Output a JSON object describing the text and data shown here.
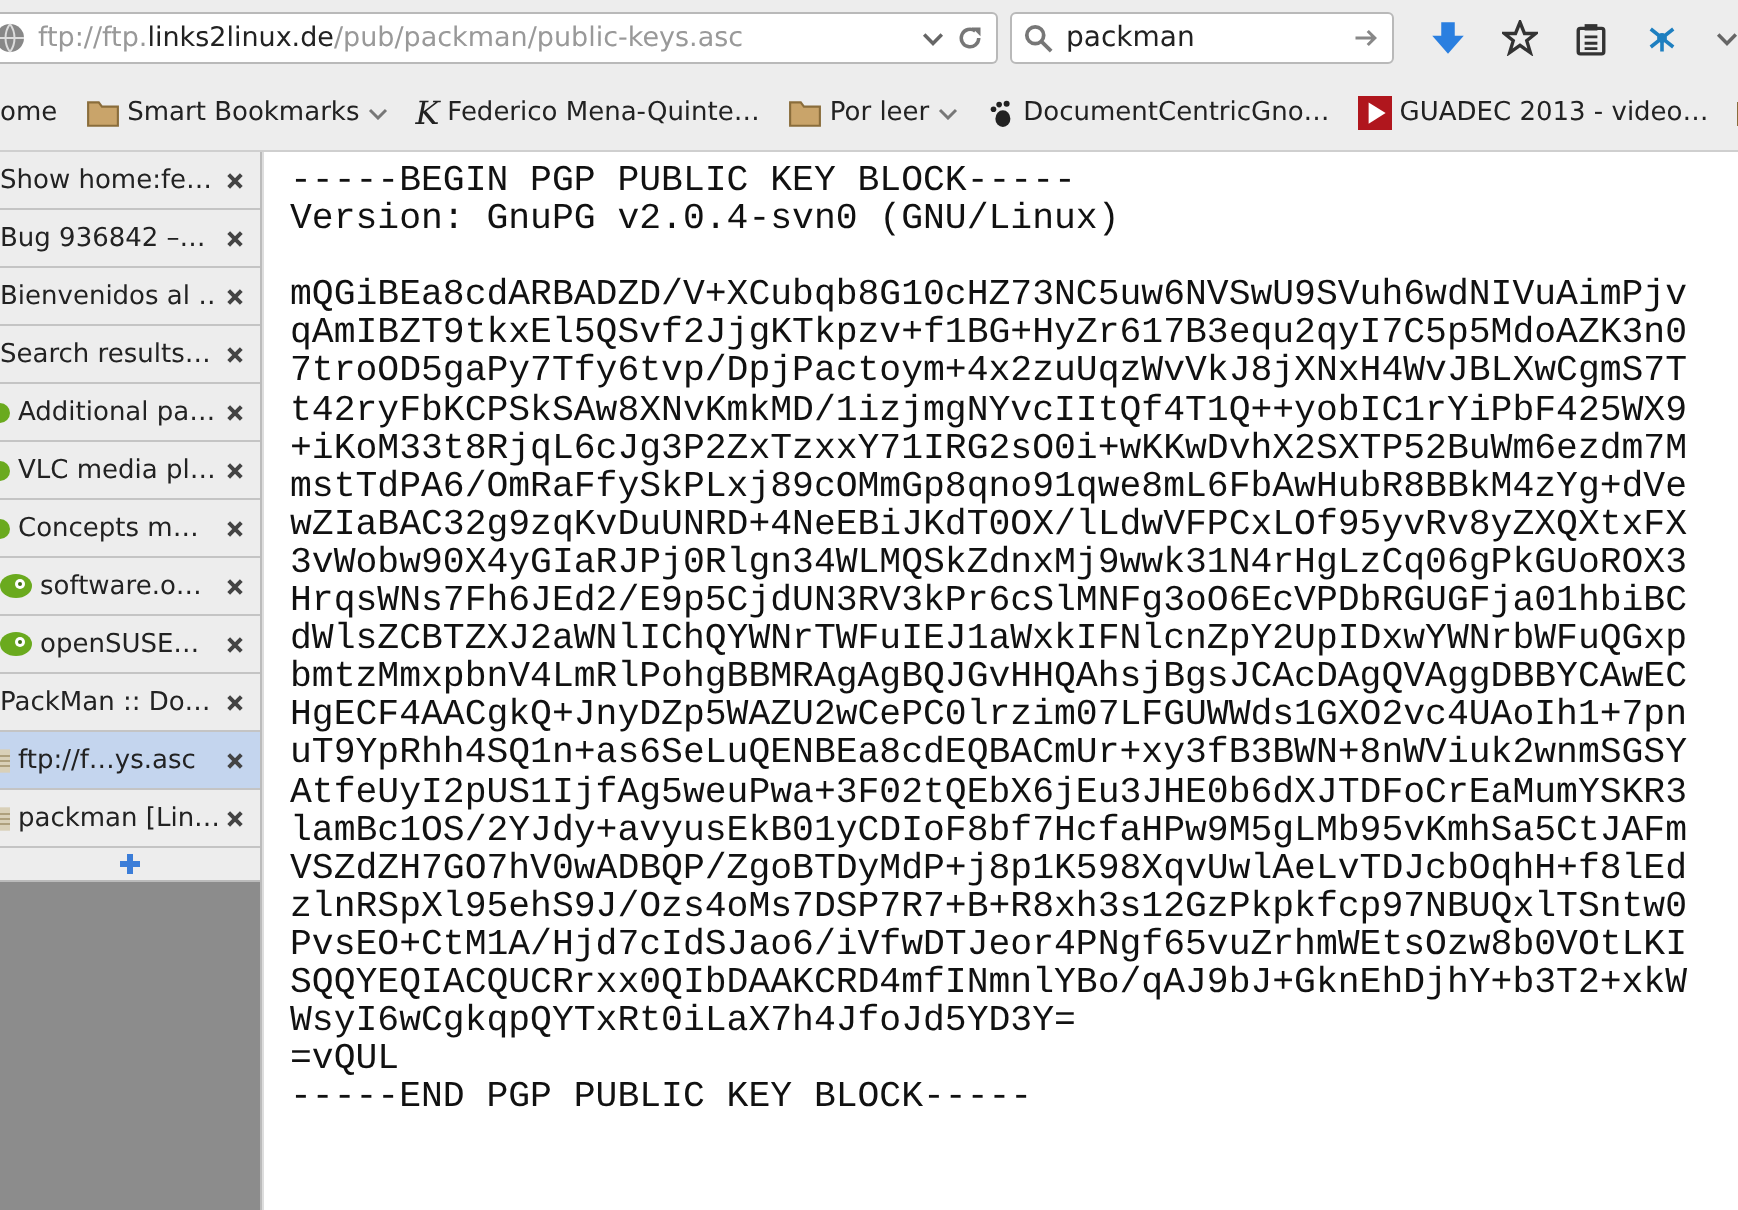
{
  "toolbar": {
    "url": {
      "scheme": "ftp://ftp.",
      "domain": "links2linux.de",
      "path": "/pub/packman/public-keys.asc"
    },
    "search": {
      "value": "packman"
    }
  },
  "bookmarks": [
    {
      "label": "ome",
      "kind": "none",
      "dropdown": false
    },
    {
      "label": "Smart Bookmarks",
      "kind": "folder",
      "dropdown": true
    },
    {
      "label": "Federico Mena-Quinte…",
      "kind": "letter",
      "glyph": "K",
      "dropdown": false
    },
    {
      "label": "Por leer",
      "kind": "folder",
      "dropdown": true
    },
    {
      "label": "DocumentCentricGno…",
      "kind": "foot",
      "dropdown": false
    },
    {
      "label": "GUADEC 2013 - video…",
      "kind": "video",
      "dropdown": false
    }
  ],
  "tabs": [
    {
      "label": "Show home:fe…",
      "kind": "none",
      "selected": false
    },
    {
      "label": "Bug 936842 –…",
      "kind": "none",
      "selected": false
    },
    {
      "label": "Bienvenidos al …",
      "kind": "none",
      "selected": false
    },
    {
      "label": "Search results…",
      "kind": "none",
      "selected": false
    },
    {
      "label": "Additional pa…",
      "kind": "dot",
      "selected": false
    },
    {
      "label": "VLC media pl…",
      "kind": "dot",
      "selected": false
    },
    {
      "label": "Concepts m…",
      "kind": "dot",
      "selected": false
    },
    {
      "label": "software.o…",
      "kind": "suse",
      "selected": false
    },
    {
      "label": "openSUSE…",
      "kind": "suse",
      "selected": false
    },
    {
      "label": "PackMan :: Do…",
      "kind": "none",
      "selected": false
    },
    {
      "label": "ftp://f…ys.asc",
      "kind": "page",
      "selected": true
    },
    {
      "label": "packman [Lin…",
      "kind": "page",
      "selected": false
    }
  ],
  "document": {
    "header": [
      "-----BEGIN PGP PUBLIC KEY BLOCK-----",
      "Version: GnuPG v2.0.4-svn0 (GNU/Linux)"
    ],
    "body": [
      "mQGiBEa8cdARBADZD/V+XCubqb8G10cHZ73NC5uw6NVSwU9SVuh6wdNIVuAimPjv",
      "qAmIBZT9tkxEl5QSvf2JjgKTkpzv+f1BG+HyZr617B3equ2qyI7C5p5MdoAZK3n0",
      "7troOD5gaPy7Tfy6tvp/DpjPactoym+4x2zuUqzWvVkJ8jXNxH4WvJBLXwCgmS7T",
      "t42ryFbKCPSkSAw8XNvKmkMD/1izjmgNYvcIItQf4T1Q++yobIC1rYiPbF425WX9",
      "+iKoM33t8RjqL6cJg3P2ZxTzxxY71IRG2sO0i+wKKwDvhX2SXTP52BuWm6ezdm7M",
      "mstTdPA6/OmRaFfySkPLxj89cOMmGp8qno91qwe8mL6FbAwHubR8BBkM4zYg+dVe",
      "wZIaBAC32g9zqKvDuUNRD+4NeEBiJKdT0OX/lLdwVFPCxLOf95yvRv8yZXQXtxFX",
      "3vWobw90X4yGIaRJPj0Rlgn34WLMQSkZdnxMj9wwk31N4rHgLzCq06gPkGUoROX3",
      "HrqsWNs7Fh6JEd2/E9p5CjdUN3RV3kPr6cSlMNFg3oO6EcVPDbRGUGFja01hbiBC",
      "dWlsZCBTZXJ2aWNlIChQYWNrTWFuIEJ1aWxkIFNlcnZpY2UpIDxwYWNrbWFuQGxp",
      "bmtzMmxpbnV4LmRlPohgBBMRAgAgBQJGvHHQAhsjBgsJCAcDAgQVAggDBBYCAwEC",
      "HgECF4AACgkQ+JnyDZp5WAZU2wCePC0lrzim07LFGUWWds1GXO2vc4UAoIh1+7pn",
      "uT9YpRhh4SQ1n+as6SeLuQENBEa8cdEQBACmUr+xy3fB3BWN+8nWViuk2wnmSGSY",
      "AtfeUyI2pUS1IjfAg5weuPwa+3F02tQEbX6jEu3JHE0b6dXJTDFoCrEaMumYSKR3",
      "lamBc1OS/2YJdy+avyusEkB01yCDIoF8bf7HcfaHPw9M5gLMb95vKmhSa5CtJAFm",
      "VSZdZH7GO7hV0wADBQP/ZgoBTDyMdP+j8p1K598XqvUwlAeLvTDJcbOqhH+f8lEd",
      "zlnRSpXl95ehS9J/Ozs4oMs7DSP7R7+B+R8xh3s12GzPkpkfcp97NBUQxlTSntw0",
      "PvsEO+CtM1A/Hjd7cIdSJao6/iVfwDTJeor4PNgf65vuZrhmWEtsOzw8b0VOtLKI",
      "SQQYEQIACQUCRrxx0QIbDAAKCRD4mfINmnlYBo/qAJ9bJ+GknEhDjhY+b3T2+xkW",
      "WsyI6wCgkqpQYTxRt0iLaX7h4JfoJd5YD3Y=",
      "=vQUL"
    ],
    "footer": [
      "-----END PGP PUBLIC KEY BLOCK-----"
    ]
  }
}
